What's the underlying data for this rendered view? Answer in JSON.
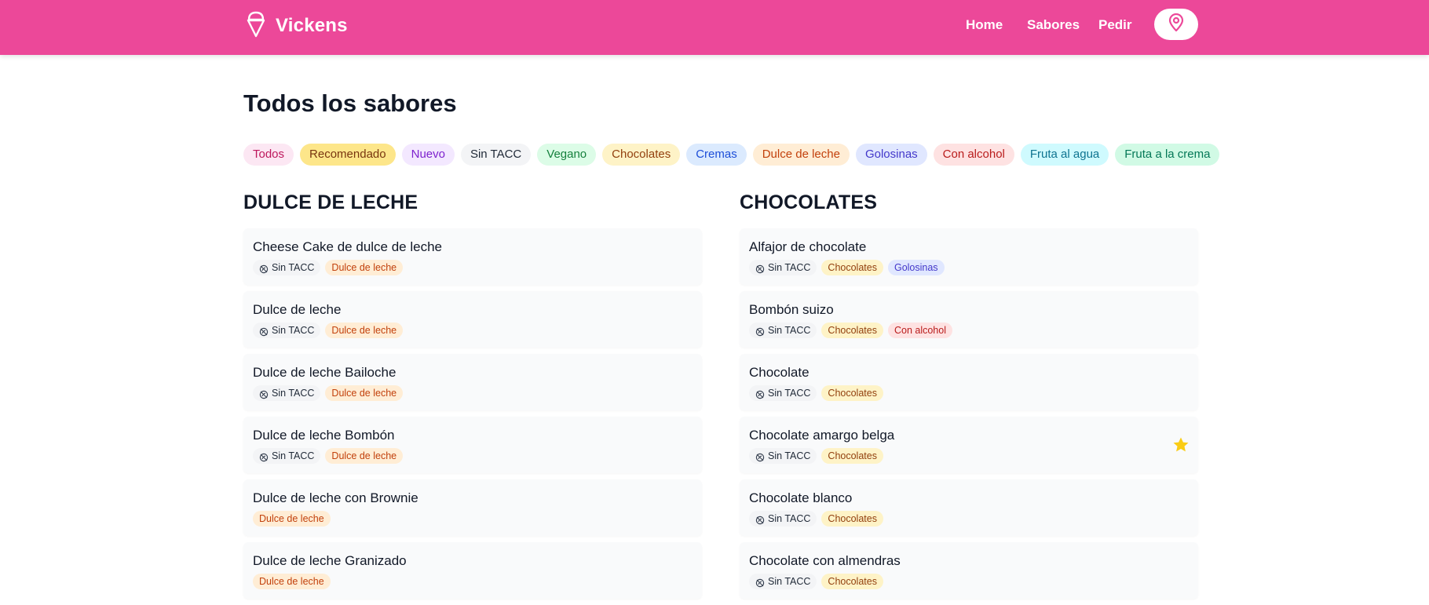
{
  "header": {
    "brand": "Vickens",
    "nav": [
      "Home",
      "Sabores",
      "Pedir"
    ]
  },
  "page": {
    "title": "Todos los sabores"
  },
  "filters": [
    {
      "label": "Todos",
      "bg": "#fce7f3",
      "fg": "#be185d"
    },
    {
      "label": "Recomendado",
      "bg": "#fde68a",
      "fg": "#78350f"
    },
    {
      "label": "Nuevo",
      "bg": "#f3e8ff",
      "fg": "#7e22ce"
    },
    {
      "label": "Sin TACC",
      "bg": "#f3f4f6",
      "fg": "#1f2937"
    },
    {
      "label": "Vegano",
      "bg": "#dcfce7",
      "fg": "#15803d"
    },
    {
      "label": "Chocolates",
      "bg": "#fef3c7",
      "fg": "#92400e"
    },
    {
      "label": "Cremas",
      "bg": "#dbeafe",
      "fg": "#1d4ed8"
    },
    {
      "label": "Dulce de leche",
      "bg": "#ffedd5",
      "fg": "#c2410c"
    },
    {
      "label": "Golosinas",
      "bg": "#e0e7ff",
      "fg": "#4338ca"
    },
    {
      "label": "Con alcohol",
      "bg": "#fee2e2",
      "fg": "#b91c1c"
    },
    {
      "label": "Fruta al agua",
      "bg": "#cffafe",
      "fg": "#0e7490"
    },
    {
      "label": "Fruta a la crema",
      "bg": "#d1fae5",
      "fg": "#047857"
    }
  ],
  "tag_styles": {
    "Sin TACC": {
      "bg": "#f3f4f6",
      "fg": "#1f2937"
    },
    "Dulce de leche": {
      "bg": "#ffedd5",
      "fg": "#c2410c"
    },
    "Chocolates": {
      "bg": "#fef3c7",
      "fg": "#92400e"
    },
    "Golosinas": {
      "bg": "#e0e7ff",
      "fg": "#4338ca"
    },
    "Con alcohol": {
      "bg": "#fee2e2",
      "fg": "#b91c1c"
    }
  },
  "sections": [
    {
      "title": "DULCE DE LECHE",
      "items": [
        {
          "name": "Cheese Cake de dulce de leche",
          "tags": [
            "Sin TACC",
            "Dulce de leche"
          ],
          "recommended": false
        },
        {
          "name": "Dulce de leche",
          "tags": [
            "Sin TACC",
            "Dulce de leche"
          ],
          "recommended": false
        },
        {
          "name": "Dulce de leche Bailoche",
          "tags": [
            "Sin TACC",
            "Dulce de leche"
          ],
          "recommended": false
        },
        {
          "name": "Dulce de leche Bombón",
          "tags": [
            "Sin TACC",
            "Dulce de leche"
          ],
          "recommended": false
        },
        {
          "name": "Dulce de leche con Brownie",
          "tags": [
            "Dulce de leche"
          ],
          "recommended": false
        },
        {
          "name": "Dulce de leche Granizado",
          "tags": [
            "Dulce de leche"
          ],
          "recommended": false
        }
      ]
    },
    {
      "title": "CHOCOLATES",
      "items": [
        {
          "name": "Alfajor de chocolate",
          "tags": [
            "Sin TACC",
            "Chocolates",
            "Golosinas"
          ],
          "recommended": false
        },
        {
          "name": "Bombón suizo",
          "tags": [
            "Sin TACC",
            "Chocolates",
            "Con alcohol"
          ],
          "recommended": false
        },
        {
          "name": "Chocolate",
          "tags": [
            "Sin TACC",
            "Chocolates"
          ],
          "recommended": false
        },
        {
          "name": "Chocolate amargo belga",
          "tags": [
            "Sin TACC",
            "Chocolates"
          ],
          "recommended": true
        },
        {
          "name": "Chocolate blanco",
          "tags": [
            "Sin TACC",
            "Chocolates"
          ],
          "recommended": false
        },
        {
          "name": "Chocolate con almendras",
          "tags": [
            "Sin TACC",
            "Chocolates"
          ],
          "recommended": false
        }
      ]
    }
  ],
  "colors": {
    "brand": "#ec4899",
    "star": "#facc15"
  },
  "icons": {
    "brand": "ice-cream-icon",
    "location": "map-pin-icon",
    "gluten_free": "wheat-off-icon",
    "recommended": "star-icon"
  }
}
